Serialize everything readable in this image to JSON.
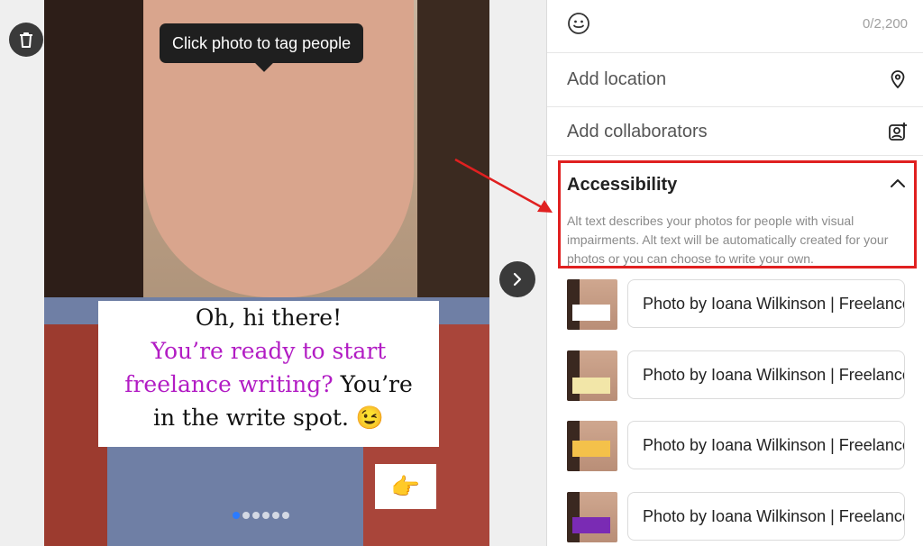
{
  "tooltip": "Click photo to tag people",
  "caption": {
    "line1": "Oh, hi there!",
    "purple_line1": "You’re ready to start",
    "purple_line2": "freelance writing?",
    "rest_line2": " You’re",
    "line3": "in the write spot. 😉"
  },
  "emoji_hint": "👉",
  "carousel": {
    "dots": 6,
    "active_index": 0
  },
  "panel": {
    "char_counter": "0/2,200",
    "add_location": "Add location",
    "add_collaborators": "Add collaborators",
    "accessibility": {
      "title": "Accessibility",
      "description": "Alt text describes your photos for people with visual impairments. Alt text will be automatically created for your photos or you can choose to write your own."
    },
    "alt_texts": [
      "Photo by Ioana Wilkinson | Freelance",
      "Photo by Ioana Wilkinson | Freelance",
      "Photo by Ioana Wilkinson | Freelance",
      "Photo by Ioana Wilkinson | Freelance"
    ]
  },
  "colors": {
    "annotation_red": "#e02020",
    "caption_purple": "#b21cc4",
    "active_dot": "#2b7bff"
  },
  "icons": [
    "trash-icon",
    "chevron-right-icon",
    "smile-icon",
    "location-pin-icon",
    "add-collaborator-icon",
    "chevron-up-icon",
    "arrow-annotation"
  ]
}
